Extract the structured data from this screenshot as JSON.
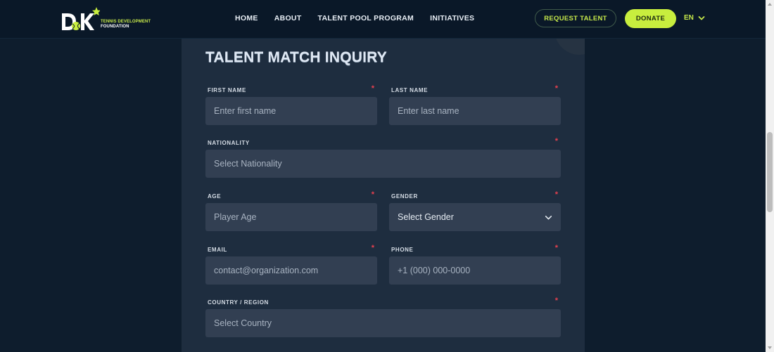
{
  "header": {
    "logo": {
      "mark_text": "DK",
      "tagline_line1": "TENNIS DEVELOPMENT",
      "tagline_line2": "FOUNDATION"
    },
    "nav": [
      "HOME",
      "ABOUT",
      "TALENT POOL PROGRAM",
      "INITIATIVES"
    ],
    "request_label": "REQUEST TALENT",
    "donate_label": "DONATE",
    "language": "EN",
    "accent_color": "#c8ee3e"
  },
  "form": {
    "title": "TALENT MATCH INQUIRY",
    "first_name": {
      "label": "FIRST NAME",
      "placeholder": "Enter first name",
      "required": "*"
    },
    "last_name": {
      "label": "LAST NAME",
      "placeholder": "Enter last name",
      "required": "*"
    },
    "nationality": {
      "label": "NATIONALITY",
      "placeholder": "Select Nationality",
      "required": "*"
    },
    "age": {
      "label": "AGE",
      "placeholder": "Player Age",
      "required": "*"
    },
    "gender": {
      "label": "GENDER",
      "selected": "Select Gender",
      "required": "*"
    },
    "email": {
      "label": "EMAIL",
      "placeholder": "contact@organization.com",
      "required": "*"
    },
    "phone": {
      "label": "PHONE",
      "placeholder": "+1 (000) 000-0000",
      "required": "*"
    },
    "country": {
      "label": "COUNTRY / REGION",
      "placeholder": "Select Country",
      "required": "*"
    }
  }
}
